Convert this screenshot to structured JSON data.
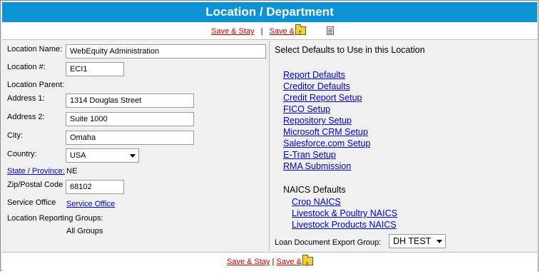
{
  "title": "Location / Department",
  "toolbar": {
    "save_stay": "Save & Stay",
    "separator": "|",
    "save_and": "Save &"
  },
  "form": {
    "location_name_label": "Location Name:",
    "location_name_value": "WebEquity Administration",
    "location_num_label": "Location #:",
    "location_num_value": "ECI1",
    "location_parent_label": "Location Parent:",
    "address1_label": "Address 1:",
    "address1_value": "1314 Douglas Street",
    "address2_label": "Address 2:",
    "address2_value": "Suite 1000",
    "city_label": "City:",
    "city_value": "Omaha",
    "country_label": "Country:",
    "country_value": "USA",
    "state_label": "State / Province:",
    "state_value": "NE",
    "zip_label": "Zip/Postal Code",
    "zip_value": "68102",
    "service_office_label": "Service Office",
    "service_office_link": "Service Office",
    "reporting_groups_label": "Location Reporting Groups:",
    "reporting_groups_value": "All Groups"
  },
  "defaults": {
    "heading": "Select Defaults to Use in this Location",
    "links": [
      "Report Defaults",
      "Creditor Defaults",
      "Credit Report Setup",
      "FICO Setup",
      "Repository Setup",
      "Microsoft CRM Setup",
      "Salesforce.com Setup",
      "E-Tran Setup",
      "RMA Submission"
    ],
    "naics_heading": "NAICS Defaults",
    "naics_links": [
      "Crop NAICS",
      "Livestock & Poultry NAICS",
      "Livestock Products NAICS"
    ],
    "export_group_label": "Loan Document Export Group:",
    "export_group_value": "DH TEST"
  },
  "bottom": {
    "save_stay": "Save & Stay",
    "separator": "|",
    "save_and": "Save &"
  },
  "colors": {
    "title_bar": "#0b93d6",
    "link_red": "#c00000",
    "link_blue": "#0000cc"
  }
}
